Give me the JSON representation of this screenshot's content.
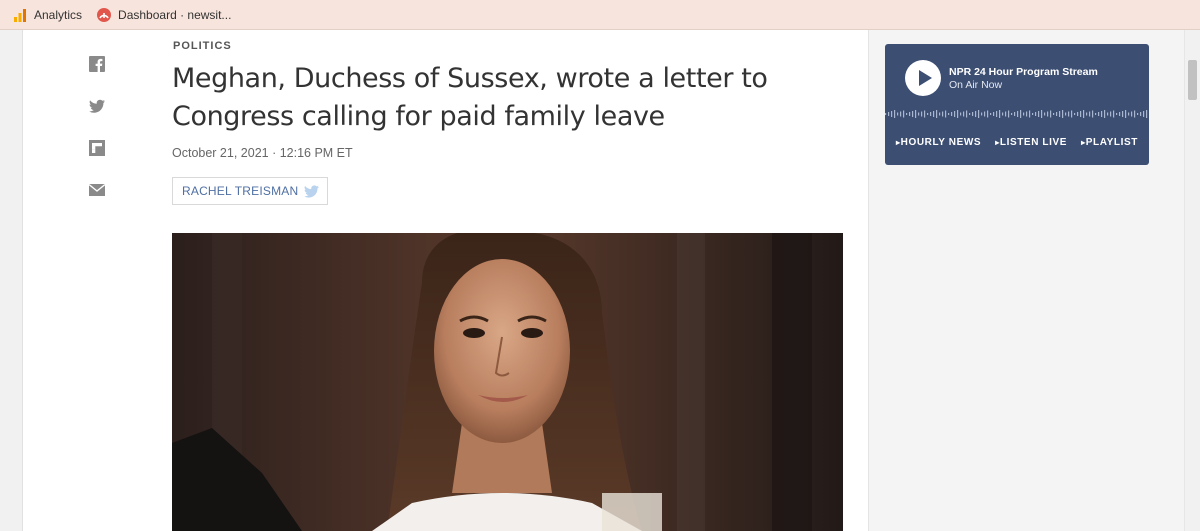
{
  "bookmarks": [
    {
      "label": "Analytics",
      "icon": "analytics-icon"
    },
    {
      "label": "Dashboard · newsit...",
      "icon": "dashboard-icon"
    }
  ],
  "share": [
    {
      "icon": "facebook-icon"
    },
    {
      "icon": "twitter-icon"
    },
    {
      "icon": "flipboard-icon"
    },
    {
      "icon": "email-icon"
    }
  ],
  "article": {
    "slug": "POLITICS",
    "headline": "Meghan, Duchess of Sussex, wrote a letter to Congress calling for paid family leave",
    "dateline": "October 21, 2021 · 12:16 PM ET",
    "author": "RACHEL TREISMAN"
  },
  "player": {
    "title": "NPR 24 Hour Program Stream",
    "subtitle": "On Air Now",
    "links": [
      "HOURLY NEWS",
      "LISTEN LIVE",
      "PLAYLIST"
    ]
  },
  "colors": {
    "bookmark_bar": "#f7e4dc",
    "player_bg": "#3c4e72",
    "byline_link": "#4f6fa3",
    "share_icon": "#8a8a8a"
  }
}
